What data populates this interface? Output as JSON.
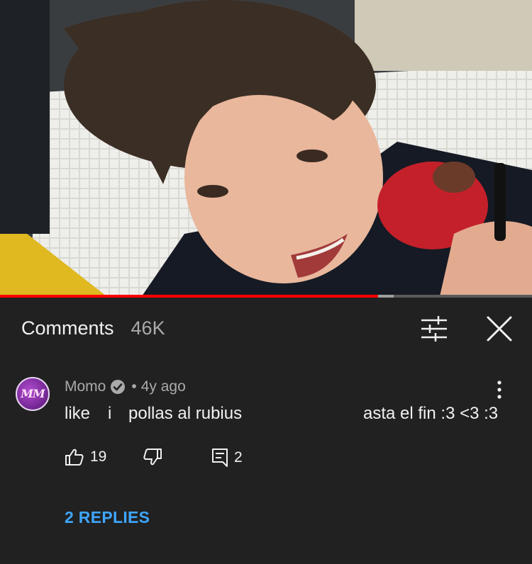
{
  "video": {
    "progress_percent": 71,
    "buffered_percent": 74
  },
  "comments_panel": {
    "title": "Comments",
    "count": "46K",
    "icons": {
      "sort": "sort-sliders-icon",
      "close": "close-icon"
    }
  },
  "comment": {
    "avatar_text": "MM",
    "author": "Momo",
    "verified_icon": "verified-check-icon",
    "separator": "•",
    "time": "4y ago",
    "text_parts": [
      "like",
      "i",
      "pollas al rubius",
      "asta el fin :3 <3 :3"
    ],
    "like_count": "19",
    "reply_count": "2",
    "replies_label": "2 REPLIES",
    "icons": {
      "like": "thumbs-up-icon",
      "dislike": "thumbs-down-icon",
      "reply": "reply-comment-icon",
      "more": "more-vertical-icon"
    }
  },
  "colors": {
    "background": "#212121",
    "accent_link": "#3ea6ff",
    "progress": "#ff0000"
  }
}
